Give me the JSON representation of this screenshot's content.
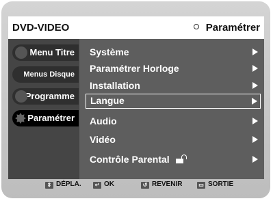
{
  "header": {
    "title": "DVD-VIDEO",
    "mode": "Paramétrer"
  },
  "sidebar": {
    "items": [
      {
        "label": "Menu Titre"
      },
      {
        "label": "Menus Disque"
      },
      {
        "label": "Programme"
      },
      {
        "label": "Paramétrer",
        "active": true
      }
    ]
  },
  "menu": {
    "items": [
      {
        "label": "Système"
      },
      {
        "label": "Paramétrer Horloge"
      },
      {
        "label": "Installation"
      },
      {
        "label": "Langue",
        "selected": true
      },
      {
        "label": "Audio"
      },
      {
        "label": "Vidéo"
      },
      {
        "label": "Contrôle Parental"
      }
    ]
  },
  "footer": {
    "move": "DÉPLA.",
    "ok": "OK",
    "back": "REVENIR",
    "exit": "SORTIE"
  },
  "icons": {
    "mode": "circle-icon",
    "lock": "lock-icon",
    "move": "up-down-icon",
    "ok": "enter-icon",
    "back": "return-icon",
    "exit": "exit-icon"
  }
}
